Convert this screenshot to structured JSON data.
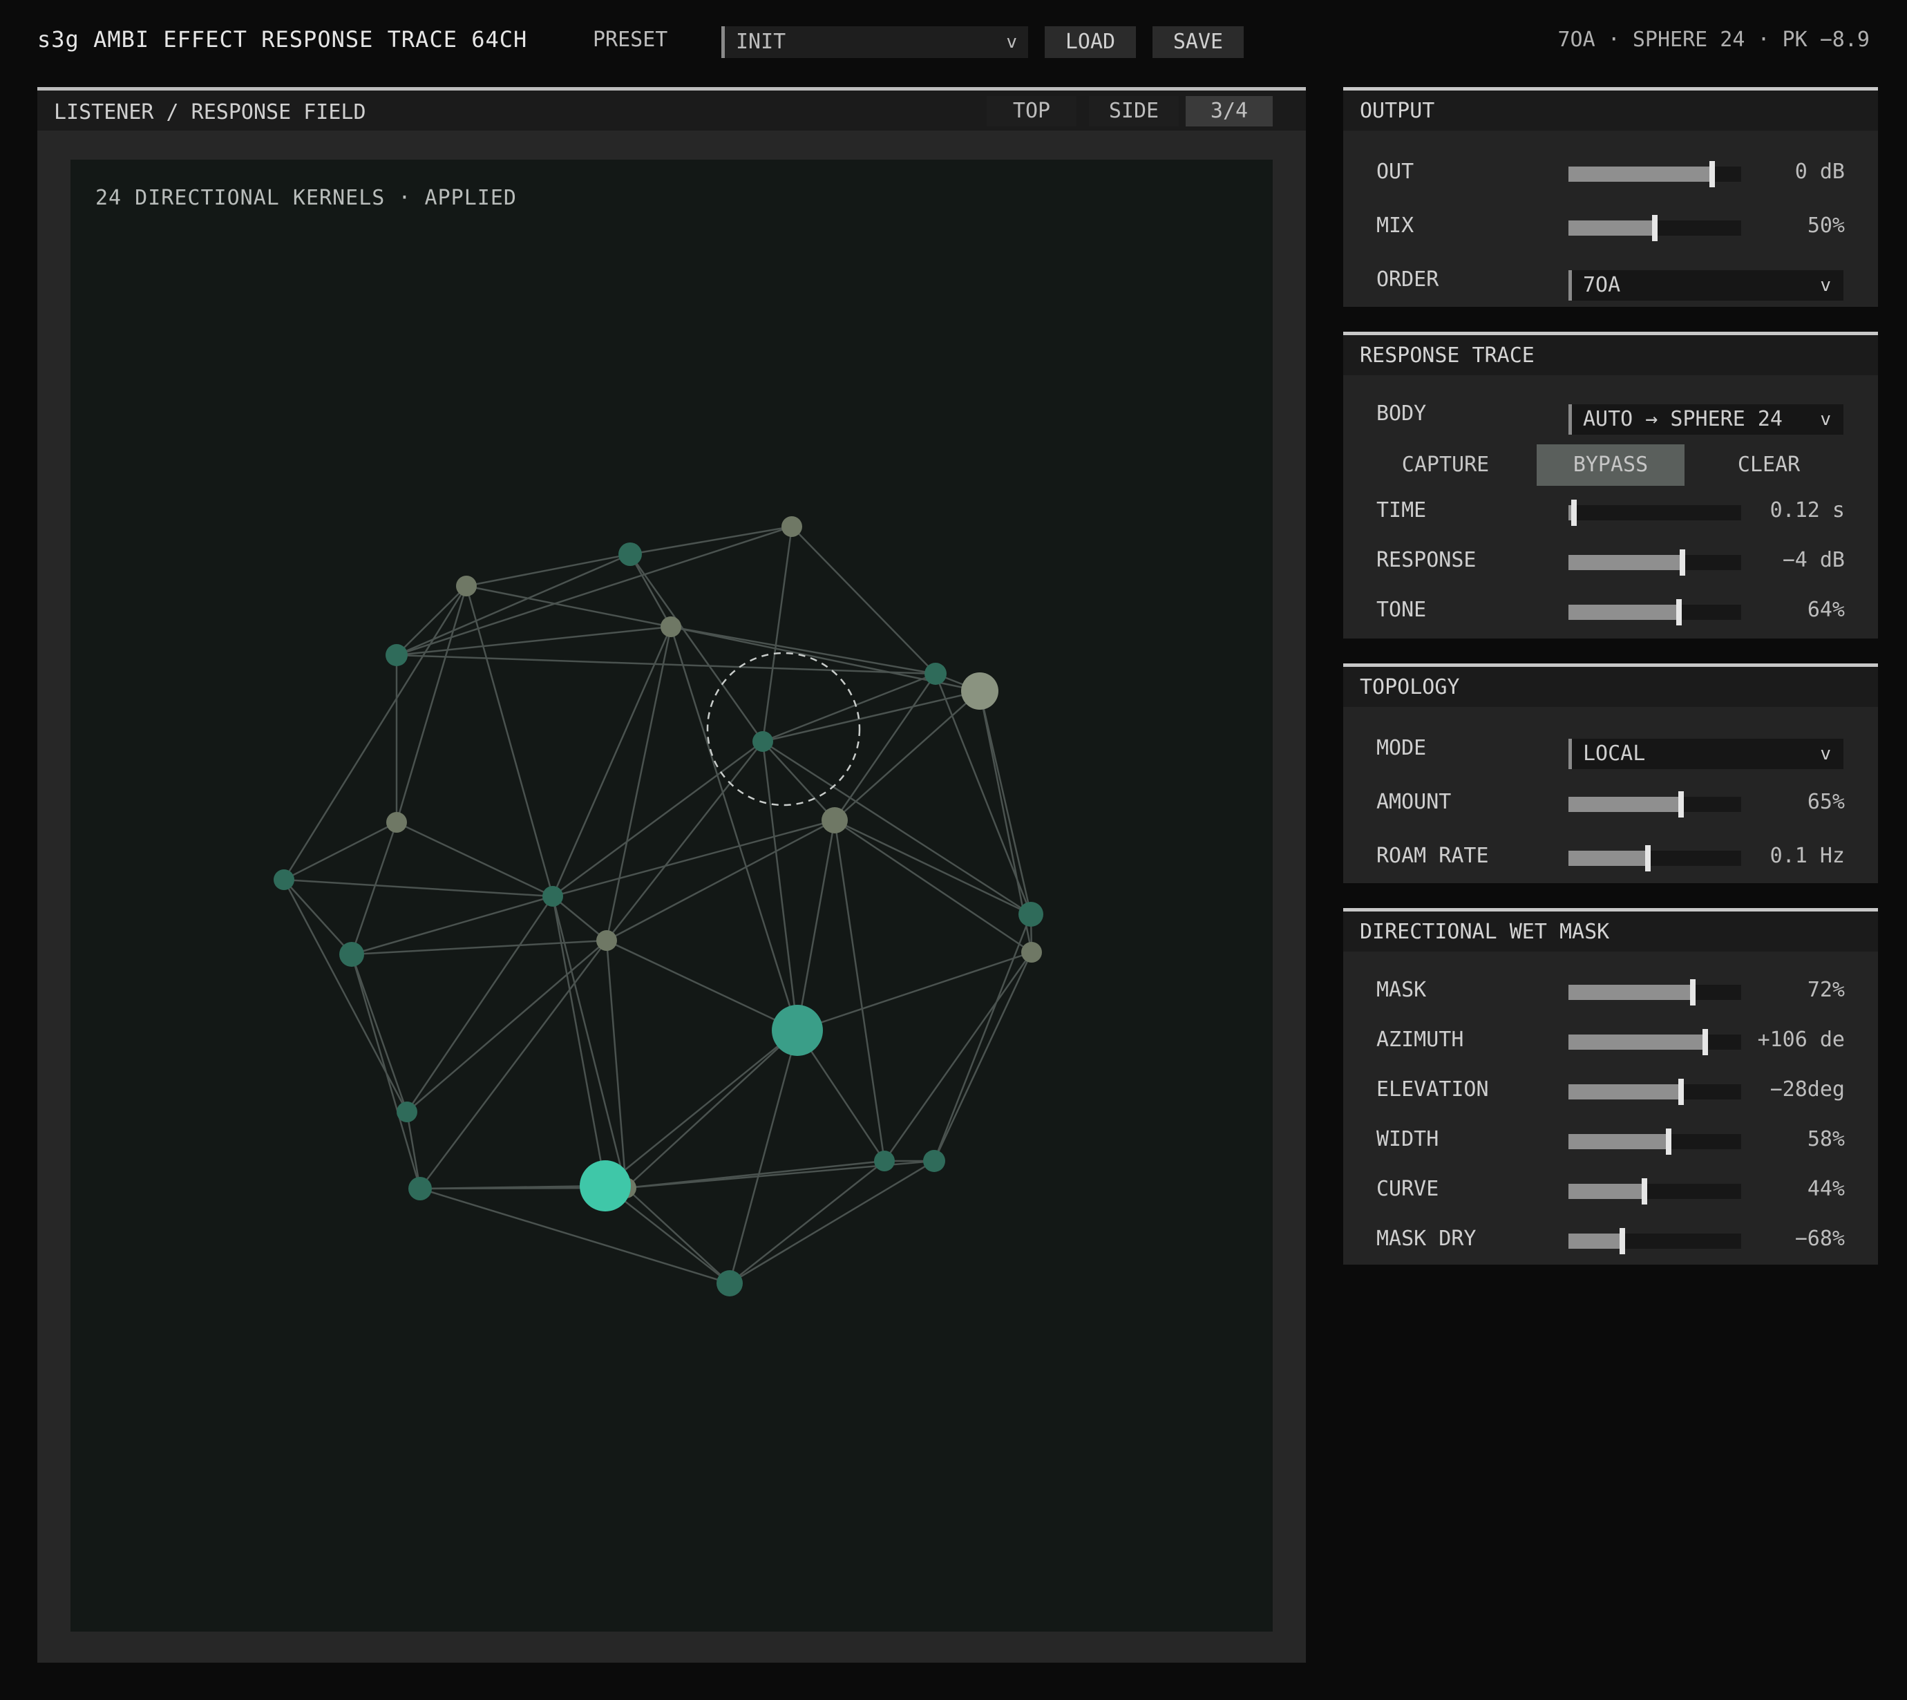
{
  "header": {
    "title": "s3g AMBI EFFECT RESPONSE TRACE 64CH",
    "preset_label": "PRESET",
    "preset_value": "INIT",
    "chevron": "v",
    "load_label": "LOAD",
    "save_label": "SAVE",
    "status": "7OA · SPHERE 24 · PK −8.9"
  },
  "field": {
    "title": "LISTENER / RESPONSE FIELD",
    "tabs": [
      {
        "label": "TOP",
        "active": false
      },
      {
        "label": "SIDE",
        "active": false
      },
      {
        "label": "3/4",
        "active": true
      }
    ],
    "caption": "24 DIRECTIONAL KERNELS · APPLIED"
  },
  "output": {
    "title": "OUTPUT",
    "out": {
      "label": "OUT",
      "value": "0 dB",
      "level": 0.83
    },
    "mix": {
      "label": "MIX",
      "value": "50%",
      "level": 0.5
    },
    "order": {
      "label": "ORDER",
      "value": "7OA"
    }
  },
  "trace": {
    "title": "RESPONSE TRACE",
    "body": {
      "label": "BODY",
      "value": "AUTO → SPHERE 24"
    },
    "capture_label": "CAPTURE",
    "bypass_label": "BYPASS",
    "clear_label": "CLEAR",
    "time": {
      "label": "TIME",
      "value": "0.12 s",
      "level": 0.03
    },
    "response": {
      "label": "RESPONSE",
      "value": "−4 dB",
      "level": 0.66
    },
    "tone": {
      "label": "TONE",
      "value": "64%",
      "level": 0.64
    }
  },
  "topology": {
    "title": "TOPOLOGY",
    "mode": {
      "label": "MODE",
      "value": "LOCAL"
    },
    "amount": {
      "label": "AMOUNT",
      "value": "65%",
      "level": 0.65
    },
    "roam": {
      "label": "ROAM RATE",
      "value": "0.1 Hz",
      "level": 0.46
    }
  },
  "mask": {
    "title": "DIRECTIONAL WET MASK",
    "mask": {
      "label": "MASK",
      "value": "72%",
      "level": 0.72
    },
    "azimuth": {
      "label": "AZIMUTH",
      "value": "+106 de",
      "level": 0.79
    },
    "elevation": {
      "label": "ELEVATION",
      "value": "−28deg",
      "level": 0.65
    },
    "width": {
      "label": "WIDTH",
      "value": "58%",
      "level": 0.58
    },
    "curve": {
      "label": "CURVE",
      "value": "44%",
      "level": 0.44
    },
    "mask_dry": {
      "label": "MASK DRY",
      "value": "−68%",
      "level": 0.31
    }
  },
  "colors": {
    "accent": "#3fc7a8",
    "node_teal": "#2f6b5a",
    "node_olive": "#6f7865",
    "edge": "#4a524f",
    "bypass_active": "#5a5f5c"
  }
}
